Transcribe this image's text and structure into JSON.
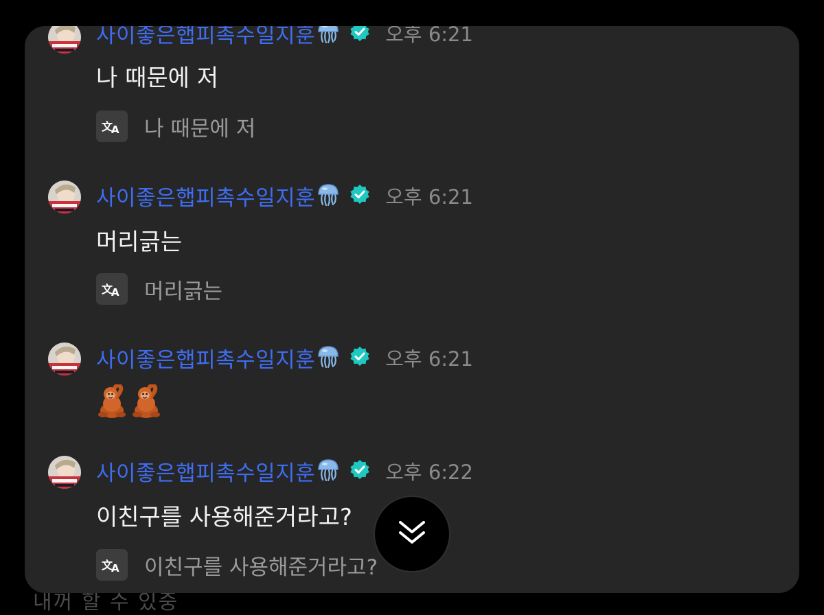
{
  "background_text": "내꺼 할 수 있중",
  "messages": [
    {
      "username": "사이좋은햅피촉수일지훈",
      "time": "오후 6:21",
      "text": "나 때문에 저",
      "translation": "나 때문에 저"
    },
    {
      "username": "사이좋은햅피촉수일지훈",
      "time": "오후 6:21",
      "text": "머리긁는",
      "translation": "머리긁는"
    },
    {
      "username": "사이좋은햅피촉수일지훈",
      "time": "오후 6:21",
      "emojis": [
        "orangutan",
        "orangutan"
      ]
    },
    {
      "username": "사이좋은햅피촉수일지훈",
      "time": "오후 6:22",
      "text": "이친구를 사용해준거라고?",
      "translation": "이친구를 사용해준거라고?"
    }
  ],
  "icons": {
    "username_emoji": "jellyfish-icon",
    "verified": "verified-badge-icon",
    "translate": "translate-icon",
    "scroll": "double-chevron-down-icon"
  },
  "colors": {
    "username": "#3f6df2",
    "verified": "#1fc8c0",
    "panel": "#262626",
    "background": "#000000"
  }
}
